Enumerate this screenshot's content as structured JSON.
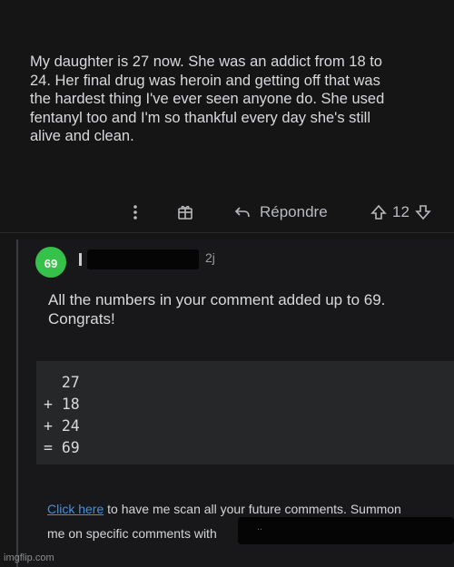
{
  "comment": {
    "text": "My daughter is 27 now. She was an addict from 18 to\n24. Her final drug was heroin and getting off that was\nthe hardest thing I've ever seen anyone do. She used\nfentanyl too and I'm so thankful every day she's still\nalive and clean."
  },
  "actions": {
    "more_icon": "more-vertical-icon",
    "award_icon": "award-icon",
    "reply_label": "Répondre",
    "upvote_icon": "arrow-up-icon",
    "score": "12",
    "downvote_icon": "arrow-down-icon"
  },
  "reply": {
    "avatar_text": "69",
    "avatar_color": "#35c14a",
    "age": "2j",
    "text": "All the numbers in your comment added up to 69.\nCongrats!",
    "code_lines": [
      "  27",
      "+ 18",
      "+ 24",
      "= 69"
    ],
    "footer_link": "Click here",
    "footer_text_1": " to have me scan all your future comments. Summon",
    "footer_text_2": "me on specific comments with",
    "link_color": "#4a8fd9"
  },
  "watermark": "imgflip.com"
}
